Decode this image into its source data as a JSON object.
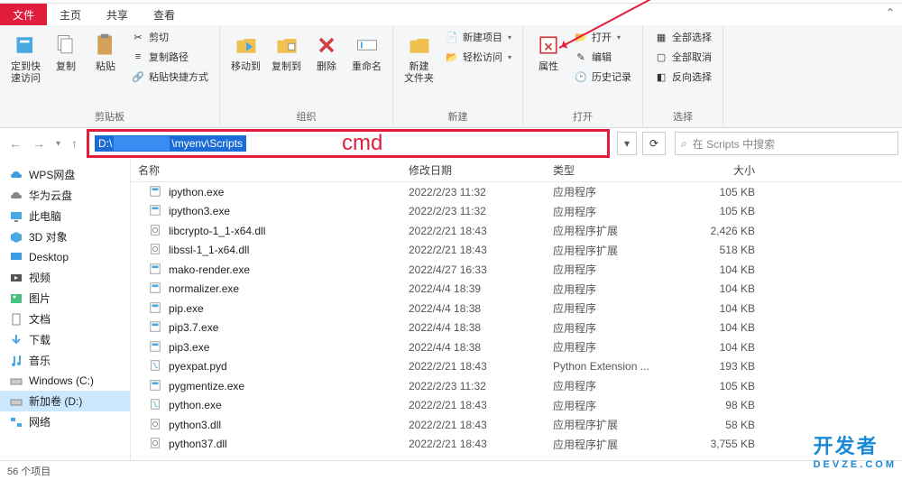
{
  "tabs": {
    "file": "文件",
    "home": "主页",
    "share": "共享",
    "view": "查看"
  },
  "ribbon": {
    "pin": "定到快\n速访问",
    "copy": "复制",
    "paste": "粘贴",
    "cut": "剪切",
    "copypath": "复制路径",
    "pasteshortcut": "粘贴快捷方式",
    "moveto": "移动到",
    "copyto": "复制到",
    "delete": "删除",
    "rename": "重命名",
    "newfolder": "新建\n文件夹",
    "newitem": "新建项目",
    "easyaccess": "轻松访问",
    "properties": "属性",
    "open": "打开",
    "edit": "编辑",
    "history": "历史记录",
    "selectall": "全部选择",
    "selectnone": "全部取消",
    "invertsel": "反向选择",
    "g_clipboard": "剪贴板",
    "g_organize": "组织",
    "g_new": "新建",
    "g_open": "打开",
    "g_select": "选择"
  },
  "address": {
    "prefix": "D:\\",
    "suffix": "\\myenv\\Scripts",
    "cmd": "cmd"
  },
  "search": {
    "placeholder": "在 Scripts 中搜索"
  },
  "columns": {
    "name": "名称",
    "date": "修改日期",
    "type": "类型",
    "size": "大小"
  },
  "sidebar": [
    {
      "icon": "cloud-blue",
      "label": "WPS网盘"
    },
    {
      "icon": "cloud-gray",
      "label": "华为云盘"
    },
    {
      "icon": "pc",
      "label": "此电脑"
    },
    {
      "icon": "cube",
      "label": "3D 对象"
    },
    {
      "icon": "desktop",
      "label": "Desktop"
    },
    {
      "icon": "video",
      "label": "视频"
    },
    {
      "icon": "picture",
      "label": "图片"
    },
    {
      "icon": "document",
      "label": "文档"
    },
    {
      "icon": "download",
      "label": "下载"
    },
    {
      "icon": "music",
      "label": "音乐"
    },
    {
      "icon": "drive",
      "label": "Windows (C:)"
    },
    {
      "icon": "drive",
      "label": "新加卷 (D:)",
      "selected": true
    },
    {
      "icon": "network",
      "label": "网络"
    }
  ],
  "files": [
    {
      "name": "ipython.exe",
      "date": "2022/2/23 11:32",
      "type": "应用程序",
      "size": "105 KB",
      "icon": "exe"
    },
    {
      "name": "ipython3.exe",
      "date": "2022/2/23 11:32",
      "type": "应用程序",
      "size": "105 KB",
      "icon": "exe"
    },
    {
      "name": "libcrypto-1_1-x64.dll",
      "date": "2022/2/21 18:43",
      "type": "应用程序扩展",
      "size": "2,426 KB",
      "icon": "dll"
    },
    {
      "name": "libssl-1_1-x64.dll",
      "date": "2022/2/21 18:43",
      "type": "应用程序扩展",
      "size": "518 KB",
      "icon": "dll"
    },
    {
      "name": "mako-render.exe",
      "date": "2022/4/27 16:33",
      "type": "应用程序",
      "size": "104 KB",
      "icon": "exe"
    },
    {
      "name": "normalizer.exe",
      "date": "2022/4/4 18:39",
      "type": "应用程序",
      "size": "104 KB",
      "icon": "exe"
    },
    {
      "name": "pip.exe",
      "date": "2022/4/4 18:38",
      "type": "应用程序",
      "size": "104 KB",
      "icon": "exe"
    },
    {
      "name": "pip3.7.exe",
      "date": "2022/4/4 18:38",
      "type": "应用程序",
      "size": "104 KB",
      "icon": "exe"
    },
    {
      "name": "pip3.exe",
      "date": "2022/4/4 18:38",
      "type": "应用程序",
      "size": "104 KB",
      "icon": "exe"
    },
    {
      "name": "pyexpat.pyd",
      "date": "2022/2/21 18:43",
      "type": "Python Extension ...",
      "size": "193 KB",
      "icon": "py"
    },
    {
      "name": "pygmentize.exe",
      "date": "2022/2/23 11:32",
      "type": "应用程序",
      "size": "105 KB",
      "icon": "exe"
    },
    {
      "name": "python.exe",
      "date": "2022/2/21 18:43",
      "type": "应用程序",
      "size": "98 KB",
      "icon": "py"
    },
    {
      "name": "python3.dll",
      "date": "2022/2/21 18:43",
      "type": "应用程序扩展",
      "size": "58 KB",
      "icon": "dll"
    },
    {
      "name": "python37.dll",
      "date": "2022/2/21 18:43",
      "type": "应用程序扩展",
      "size": "3,755 KB",
      "icon": "dll"
    }
  ],
  "status": {
    "count": "56 个项目"
  },
  "watermark": {
    "main": "开发者",
    "sub": "DEVZE.COM"
  }
}
